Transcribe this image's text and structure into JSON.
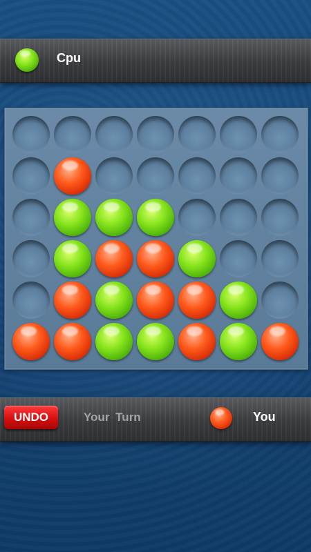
{
  "top_player": {
    "name": "Cpu",
    "disc_color": "green"
  },
  "bottom_bar": {
    "undo_label": "UNDO",
    "turn_status": "Your  Turn",
    "player_name": "You",
    "disc_color": "red"
  },
  "board": {
    "columns": 7,
    "rows": 6,
    "grid": [
      [
        "",
        "",
        "",
        "",
        "",
        "",
        ""
      ],
      [
        "",
        "red",
        "",
        "",
        "",
        "",
        ""
      ],
      [
        "",
        "green",
        "green",
        "green",
        "",
        "",
        ""
      ],
      [
        "",
        "green",
        "red",
        "red",
        "green",
        "",
        ""
      ],
      [
        "",
        "red",
        "green",
        "red",
        "red",
        "green",
        ""
      ],
      [
        "red",
        "red",
        "green",
        "green",
        "red",
        "green",
        "red"
      ]
    ]
  },
  "colors": {
    "green_disc": "#86e41c",
    "red_disc": "#ff5a1c",
    "undo_button": "#d40f0f",
    "board": "#6a8aa8",
    "background": "#1a4f82"
  }
}
